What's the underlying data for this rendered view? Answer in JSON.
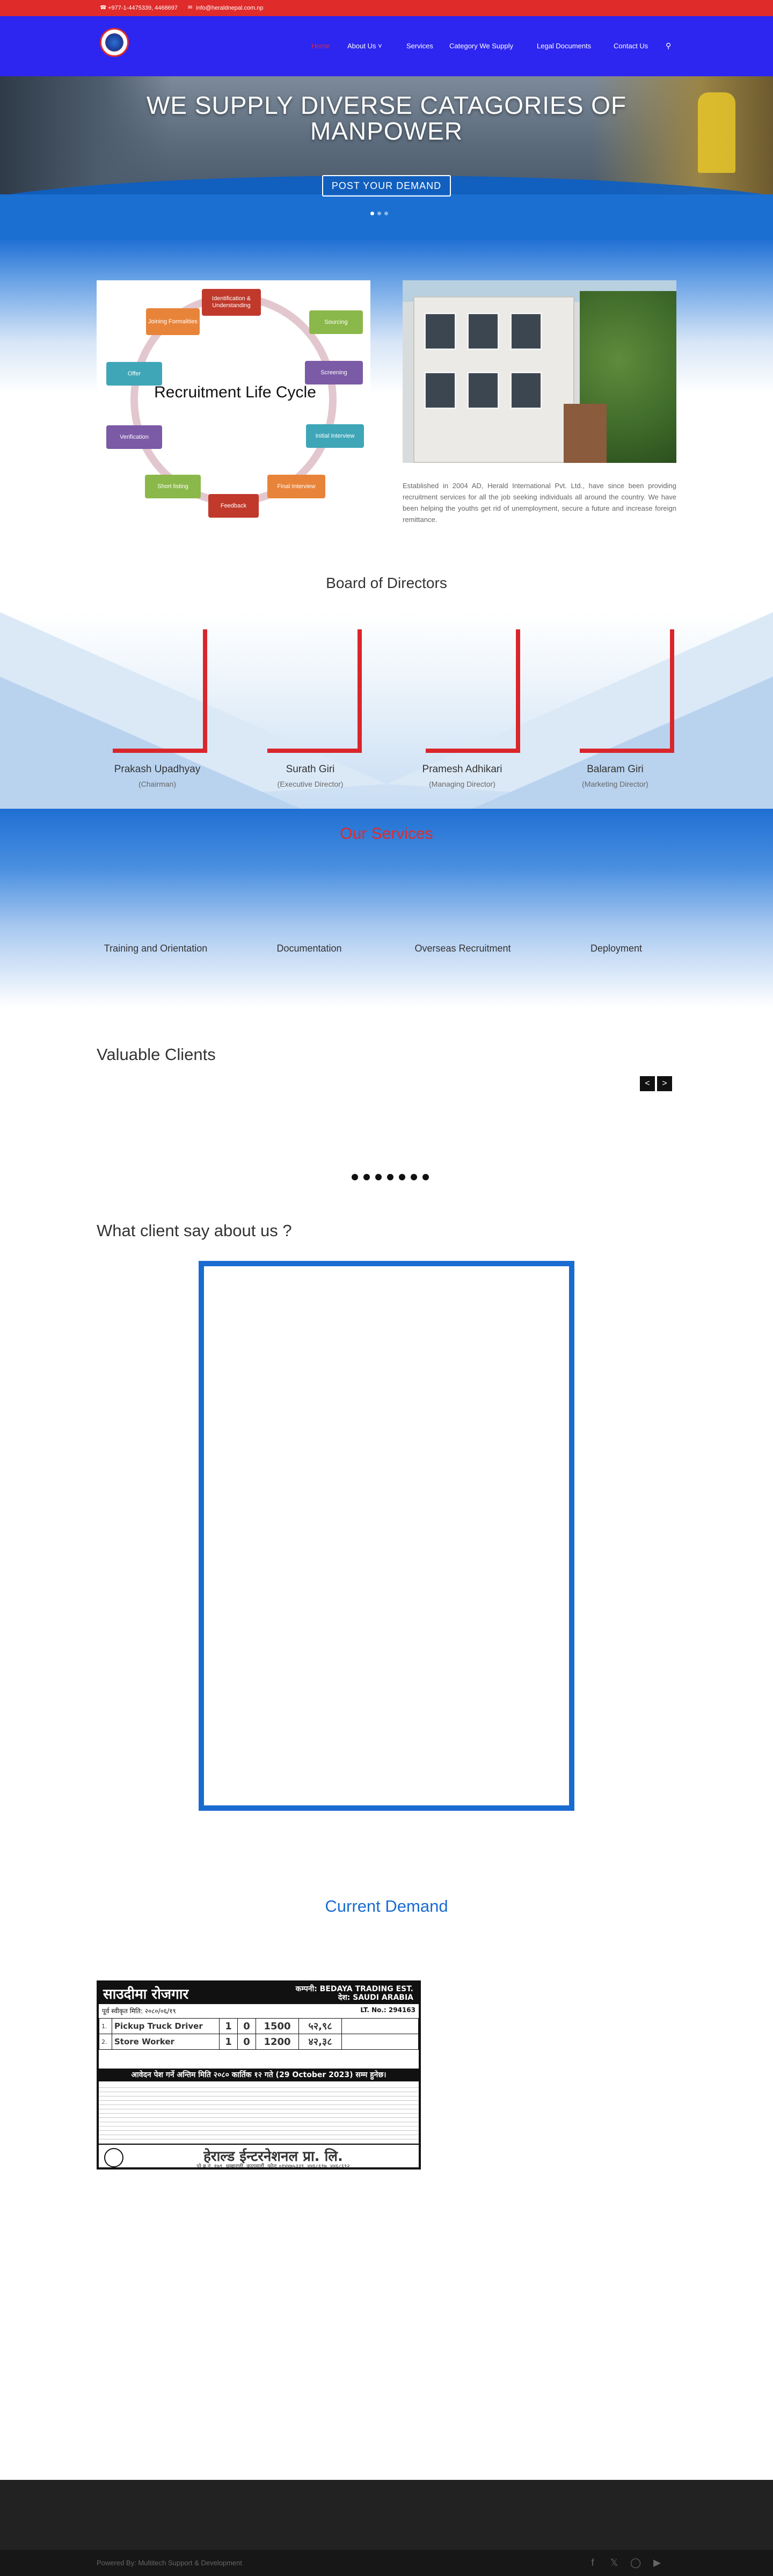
{
  "topbar": {
    "phone": "+977-1-4475339, 4468697",
    "email": "info@heraldnepal.com.np"
  },
  "nav": {
    "items": [
      {
        "label": "Home",
        "active": true
      },
      {
        "label": "About Us",
        "has_dropdown": true
      },
      {
        "label": "Services"
      },
      {
        "label": "Category We Supply"
      },
      {
        "label": "Legal Documents"
      },
      {
        "label": "Contact Us"
      }
    ],
    "search_icon": "search-icon"
  },
  "hero": {
    "title": "WE SUPPLY DIVERSE CATAGORIES OF MANPOWER",
    "button": "POST YOUR DEMAND",
    "dots_total": 3,
    "dots_active": 1
  },
  "cycle": {
    "title": "Recruitment Life Cycle",
    "nodes": [
      {
        "label": "Identification & Understanding",
        "color": "#c0392b"
      },
      {
        "label": "Sourcing",
        "color": "#8bb84a"
      },
      {
        "label": "Screening",
        "color": "#7b5aa6"
      },
      {
        "label": "Initial Interview",
        "color": "#3fa6b8"
      },
      {
        "label": "Final Interview",
        "color": "#e8843a"
      },
      {
        "label": "Feedback",
        "color": "#c0392b"
      },
      {
        "label": "Short listing",
        "color": "#8bb84a"
      },
      {
        "label": "Verification",
        "color": "#7b5aa6"
      },
      {
        "label": "Offer",
        "color": "#3fa6b8"
      },
      {
        "label": "Joining Formalities",
        "color": "#e8843a"
      }
    ]
  },
  "about": {
    "text": "Established in 2004 AD, Herald International Pvt. Ltd., have since been providing recruitment services for all the job seeking individuals all around the country. We have been helping the youths get rid of unemployment, secure a future and increase foreign remittance."
  },
  "board": {
    "title": "Board of Directors",
    "directors": [
      {
        "name": "Prakash Upadhyay",
        "role": "(Chairman)"
      },
      {
        "name": "Surath Giri",
        "role": "(Executive Director)"
      },
      {
        "name": "Pramesh Adhikari",
        "role": "(Managing Director)"
      },
      {
        "name": "Balaram Giri",
        "role": "(Marketing Director)"
      }
    ]
  },
  "services": {
    "title": "Our Services",
    "items": [
      "Training and Orientation",
      "Documentation",
      "Overseas Recruitment",
      "Deployment"
    ]
  },
  "clients": {
    "title": "Valuable Clients",
    "prev": "<",
    "next": ">",
    "dots_total": 7
  },
  "testimonials": {
    "title": "What client say about us ?"
  },
  "demand": {
    "title": "Current Demand",
    "poster": {
      "header_left": "साउदीमा रोजगार",
      "header_right_1": "कम्पनी: BEDAYA TRADING EST.",
      "header_right_2": "देश: SAUDI ARABIA",
      "date_line": "पूर्व स्वीकृत मिति: २०८०/०६/१९",
      "lt_no": "LT. No.: 294163",
      "jobs": [
        {
          "no": "1.",
          "title": "Pickup Truck Driver",
          "m": "1",
          "f": "0",
          "salary": "1500",
          "npr": "५२,९८"
        },
        {
          "no": "2.",
          "title": "Store Worker",
          "m": "1",
          "f": "0",
          "salary": "1200",
          "npr": "४२,३८"
        }
      ],
      "deadline": "आवेदन पेश गर्ने अन्तिम मिति २०८० कार्तिक १२ गते (29 October 2023) सम्म हुनेछ।",
      "company": "हेराल्ड ईन्टरनेशनल प्रा. लि.",
      "address": "पो.ब.नं. १७९, धुम्बाराही, काठमाडौं, फोनः ०१४४७५३३९, ४४६८६९७, ४४६८६९२"
    }
  },
  "footer": {
    "copyright": "Powered By: Multitech Support & Development",
    "social": [
      "facebook-icon",
      "x-icon",
      "instagram-icon",
      "youtube-icon"
    ]
  },
  "colors": {
    "accent_red": "#e02b2b",
    "header_blue": "#2d25f0",
    "brand_blue": "#1a6bd1",
    "director_red": "#d9262b"
  }
}
